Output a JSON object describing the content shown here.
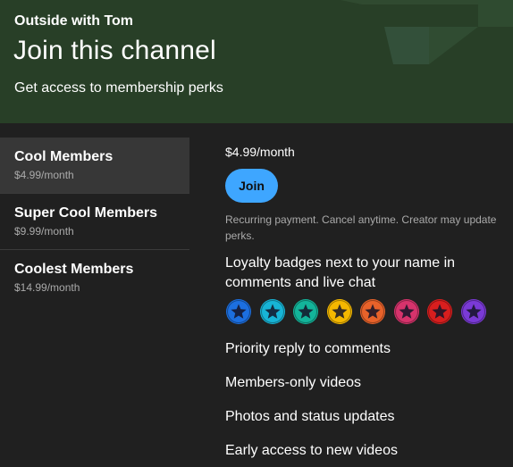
{
  "header": {
    "channel_name": "Outside with Tom",
    "title": "Join this channel",
    "subtitle": "Get access to membership perks"
  },
  "tiers": [
    {
      "name": "Cool Members",
      "price": "$4.99/month",
      "selected": true
    },
    {
      "name": "Super Cool Members",
      "price": "$9.99/month",
      "selected": false
    },
    {
      "name": "Coolest Members",
      "price": "$14.99/month",
      "selected": false
    }
  ],
  "detail": {
    "price": "$4.99/month",
    "join_label": "Join",
    "recurring_note": "Recurring payment. Cancel anytime. Creator may update perks.",
    "perks": [
      "Loyalty badges next to your name in comments and live chat",
      "Priority reply to comments",
      "Members-only videos",
      "Photos and status updates",
      "Early access to new videos"
    ],
    "badge_icons": [
      "star-badge-icon",
      "star-badge-icon",
      "star-badge-icon",
      "star-badge-icon",
      "star-badge-icon",
      "star-badge-icon",
      "star-badge-icon",
      "star-badge-icon"
    ],
    "badge_colors": [
      "#1c6fe0",
      "#17b4d6",
      "#13b49a",
      "#f5b800",
      "#e8622a",
      "#d6336c",
      "#d81e1e",
      "#7a3ad6"
    ]
  },
  "colors": {
    "header_bg": "#283f27",
    "page_bg": "#202020",
    "selected_tier_bg": "#373737",
    "join_button": "#3ea6ff"
  }
}
